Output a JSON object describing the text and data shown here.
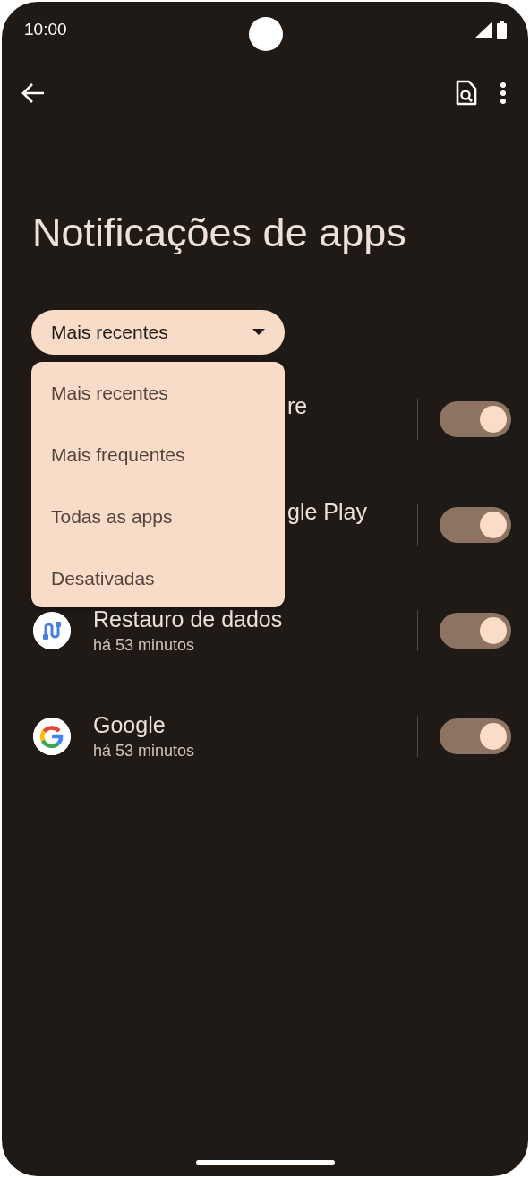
{
  "status_bar": {
    "time": "10:00"
  },
  "title": "Notificações de apps",
  "filter": {
    "value": "Mais recentes",
    "expanded": true,
    "options": [
      {
        "label": "Mais recentes"
      },
      {
        "label": "Mais frequentes"
      },
      {
        "label": "Todas as apps"
      },
      {
        "label": "Desativadas"
      }
    ]
  },
  "apps": [
    {
      "kind": "covered",
      "name": "re",
      "on": true
    },
    {
      "kind": "covered",
      "name": "gle Play",
      "on": true
    },
    {
      "kind": "cable",
      "name": "Restauro de dados",
      "time": "há 53 minutos",
      "on": true
    },
    {
      "kind": "google",
      "name": "Google",
      "time": "há 53 minutos",
      "on": true
    }
  ]
}
